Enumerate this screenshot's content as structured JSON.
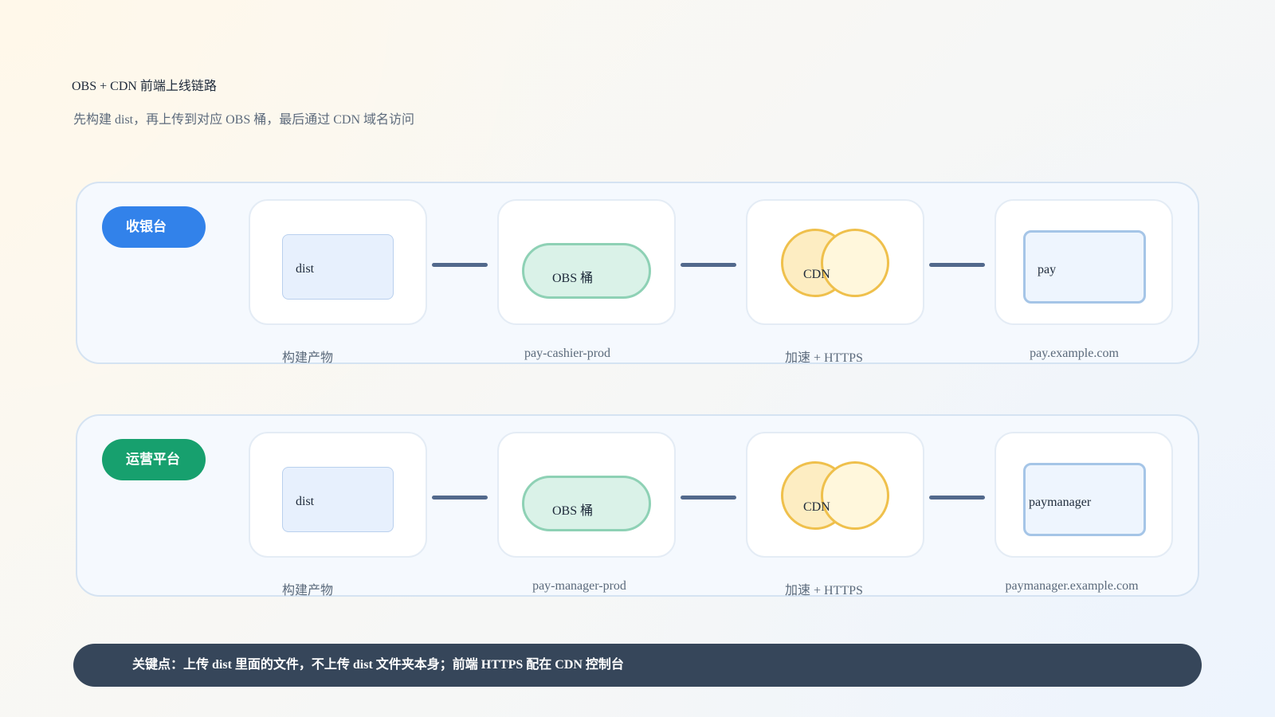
{
  "header": {
    "title": "OBS + CDN 前端上线链路",
    "subtitle": "先构建 dist，再上传到对应 OBS 桶，最后通过 CDN 域名访问"
  },
  "lanes": [
    {
      "label": "收银台",
      "label_color": "#3282ea",
      "steps": [
        {
          "box_text": "dist",
          "caption": "构建产物"
        },
        {
          "box_text": "OBS 桶",
          "caption": "pay-cashier-prod"
        },
        {
          "box_text": "CDN",
          "caption": "加速 + HTTPS"
        },
        {
          "box_text": "pay",
          "caption": "pay.example.com"
        }
      ]
    },
    {
      "label": "运营平台",
      "label_color": "#17a06e",
      "steps": [
        {
          "box_text": "dist",
          "caption": "构建产物"
        },
        {
          "box_text": "OBS 桶",
          "caption": "pay-manager-prod"
        },
        {
          "box_text": "CDN",
          "caption": "加速 + HTTPS"
        },
        {
          "box_text": "paymanager",
          "caption": "paymanager.example.com"
        }
      ]
    }
  ],
  "footer": {
    "note": "关键点：上传 dist 里面的文件，不上传 dist 文件夹本身；前端 HTTPS 配在 CDN 控制台"
  },
  "colors": {
    "lane_border": "#d5e3f2",
    "connector": "#52698c",
    "obs_border": "#8ed1b5",
    "cdn_border": "#efc04c",
    "domain_border": "#a5c5e7",
    "note_bar": "#36465a"
  }
}
